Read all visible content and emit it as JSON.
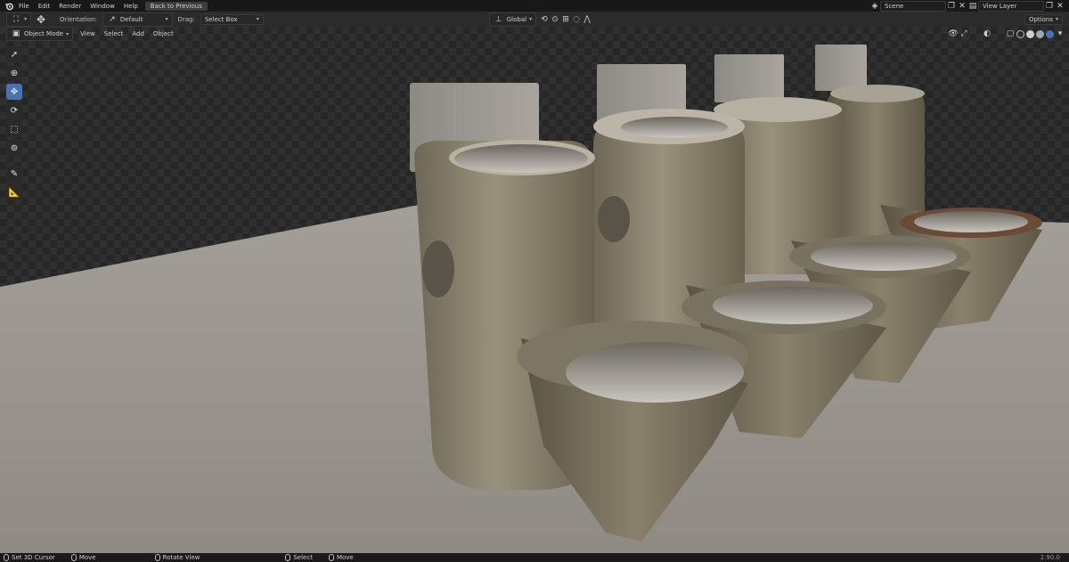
{
  "topbar": {
    "menus": [
      "File",
      "Edit",
      "Render",
      "Window",
      "Help"
    ],
    "back_button": "Back to Previous",
    "scene": "Scene",
    "view_layer": "View Layer"
  },
  "header": {
    "orientation_label": "Orientation:",
    "orientation_value": "Default",
    "drag_label": "Drag:",
    "drag_value": "Select Box",
    "transform_orientation": "Global",
    "options": "Options"
  },
  "header2": {
    "mode": "Object Mode",
    "menus": [
      "View",
      "Select",
      "Add",
      "Object"
    ]
  },
  "statusbar": {
    "items": [
      "Set 3D Cursor",
      "Move",
      "Rotate View",
      "Select",
      "Move"
    ],
    "version": "2.90.0"
  },
  "colors": {
    "active_tool": "#4772b3",
    "background": "#1d1d1d"
  }
}
